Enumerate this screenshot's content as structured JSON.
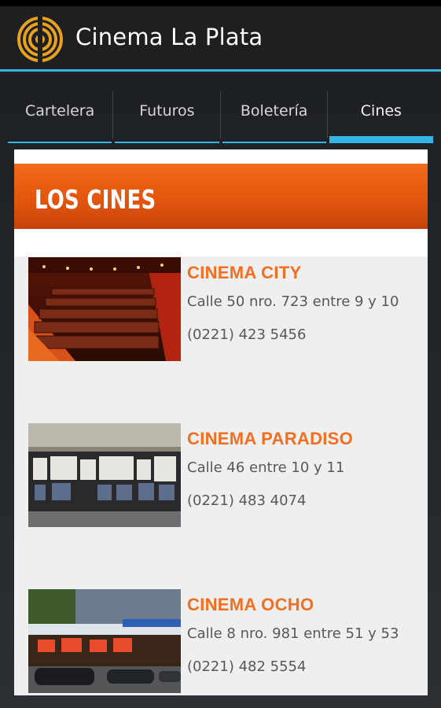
{
  "app": {
    "title": "Cinema La Plata",
    "logo_icon": "cinema-logo-icon",
    "accent_color": "#33b5e5"
  },
  "tabs": [
    {
      "label": "Cartelera",
      "active": false
    },
    {
      "label": "Futuros",
      "active": false
    },
    {
      "label": "Boletería",
      "active": false
    },
    {
      "label": "Cines",
      "active": true
    }
  ],
  "content": {
    "header": "LOS CINES",
    "header_color": "#e4560d",
    "cinemas": [
      {
        "name": "CINEMA CITY",
        "address": "Calle 50 nro. 723 entre 9 y 10",
        "phone": "(0221) 423 5456",
        "image": "auditorium-seats-photo"
      },
      {
        "name": "CINEMA PARADISO",
        "address": "Calle 46 entre 10 y 11",
        "phone": "(0221) 483 4074",
        "image": "cinema-storefront-photo"
      },
      {
        "name": "CINEMA OCHO",
        "address": "Calle 8 nro. 981 entre 51 y 53",
        "phone": "(0221) 482 5554",
        "image": "cinema-building-street-photo"
      }
    ]
  }
}
